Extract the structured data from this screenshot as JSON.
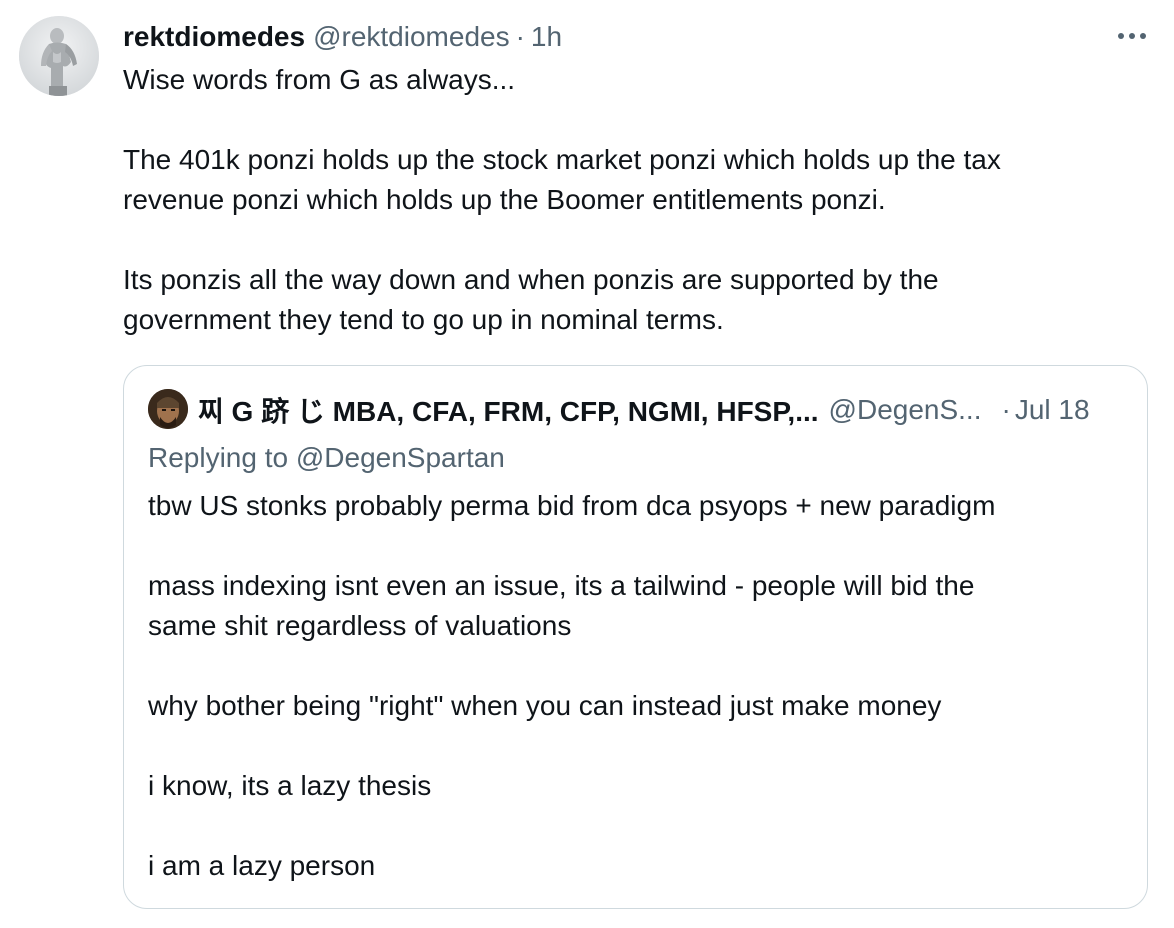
{
  "tweet": {
    "author": {
      "name": "rektdiomedes",
      "handle": "@rektdiomedes",
      "avatar_icon": "statue-avatar"
    },
    "separator": "·",
    "timestamp": "1h",
    "more_icon": "more-horizontal-icon",
    "text_lines": [
      "Wise words from G as always...",
      "",
      "The 401k ponzi holds up the stock market ponzi which holds up the tax",
      "revenue ponzi which holds up the Boomer entitlements ponzi.",
      "",
      "Its ponzis all the way down and when ponzis are supported by the",
      "government they tend to go up in nominal terms."
    ]
  },
  "quote": {
    "author": {
      "name": "찌 G 跻 じ MBA, CFA, FRM, CFP, NGMI, HFSP,...",
      "handle": "@DegenS...",
      "avatar_icon": "spartan-avatar"
    },
    "separator": "·",
    "timestamp": "Jul 18",
    "replying_prefix": "Replying to ",
    "replying_to": "@DegenSpartan",
    "text_lines": [
      "tbw US stonks probably perma bid from dca psyops + new paradigm",
      "",
      "mass indexing isnt even an issue, its a tailwind - people will bid the",
      "same shit regardless of valuations",
      "",
      "why bother being \"right\" when you can instead just make money",
      "",
      "i know, its a lazy thesis",
      "",
      "i am a lazy person"
    ]
  },
  "colors": {
    "text_primary": "#0f1419",
    "text_secondary": "#536471",
    "border": "#cfd9de",
    "background": "#ffffff"
  }
}
